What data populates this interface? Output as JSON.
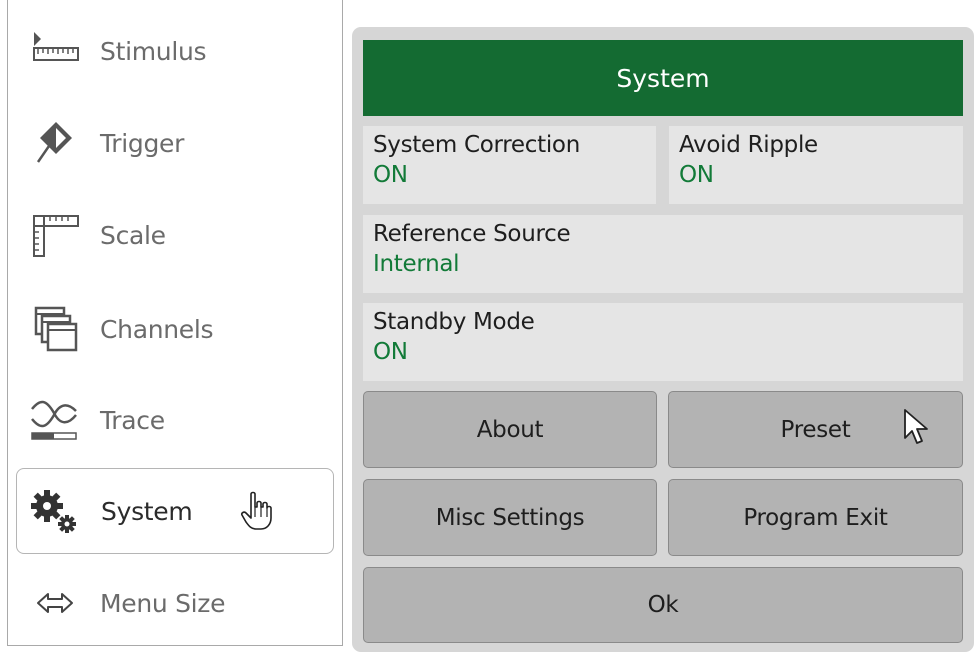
{
  "side_menu": {
    "items": [
      {
        "label": "Stimulus",
        "icon": "ruler-icon"
      },
      {
        "label": "Trigger",
        "icon": "trigger-icon"
      },
      {
        "label": "Scale",
        "icon": "scale-icon"
      },
      {
        "label": "Channels",
        "icon": "channels-icon"
      },
      {
        "label": "Trace",
        "icon": "trace-icon"
      },
      {
        "label": "System",
        "icon": "gears-icon"
      },
      {
        "label": "Menu Size",
        "icon": "double-arrow-icon"
      }
    ],
    "selected": "System"
  },
  "system_panel": {
    "title": "System",
    "system_correction": {
      "label": "System Correction",
      "value": "ON"
    },
    "avoid_ripple": {
      "label": "Avoid Ripple",
      "value": "ON"
    },
    "reference_source": {
      "label": "Reference Source",
      "value": "Internal"
    },
    "standby_mode": {
      "label": "Standby Mode",
      "value": "ON"
    },
    "buttons": {
      "about": "About",
      "preset": "Preset",
      "misc_settings": "Misc Settings",
      "program_exit": "Program Exit",
      "ok": "Ok"
    }
  },
  "colors": {
    "header_bg": "#146b32",
    "value_text": "#127a38",
    "panel_bg": "#d6d6d6",
    "field_bg": "#e5e5e5",
    "button_bg": "#b3b3b3"
  }
}
